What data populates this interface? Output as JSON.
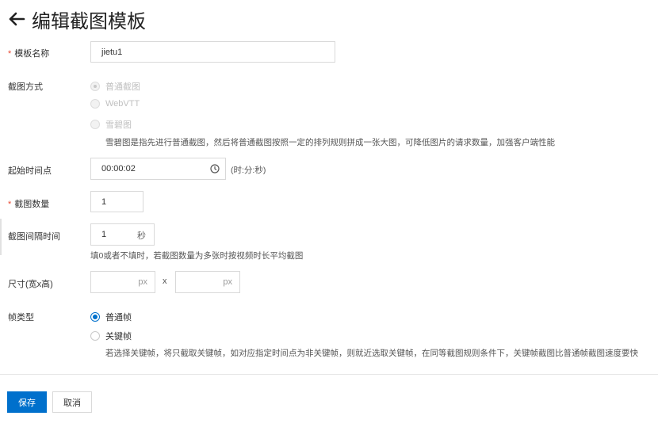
{
  "header": {
    "title": "编辑截图模板"
  },
  "form": {
    "template_name": {
      "label": "模板名称",
      "value": "jietu1"
    },
    "snapshot_method": {
      "label": "截图方式",
      "options": [
        "普通截图",
        "WebVTT",
        "雪碧图"
      ],
      "help": "雪碧图是指先进行普通截图，然后将普通截图按照一定的排列规则拼成一张大图，可降低图片的请求数量，加强客户端性能"
    },
    "start_time": {
      "label": "起始时间点",
      "value": "00:00:02",
      "format_hint": "(时:分:秒)"
    },
    "count": {
      "label": "截图数量",
      "value": "1"
    },
    "interval": {
      "label": "截图间隔时间",
      "value": "1",
      "unit": "秒",
      "help": "填0或者不填时，若截图数量为多张时按视频时长平均截图"
    },
    "size": {
      "label": "尺寸(宽x高)",
      "width_unit": "px",
      "separator": "x",
      "height_unit": "px"
    },
    "frame_type": {
      "label": "帧类型",
      "options": [
        "普通帧",
        "关键帧"
      ],
      "help": "若选择关键帧，将只截取关键帧，如对应指定时间点为非关键帧，则就近选取关键帧，在同等截图规则条件下，关键帧截图比普通帧截图速度要快"
    }
  },
  "footer": {
    "save_label": "保存",
    "cancel_label": "取消"
  },
  "colors": {
    "primary": "#0070cc",
    "required": "#e94b35"
  }
}
